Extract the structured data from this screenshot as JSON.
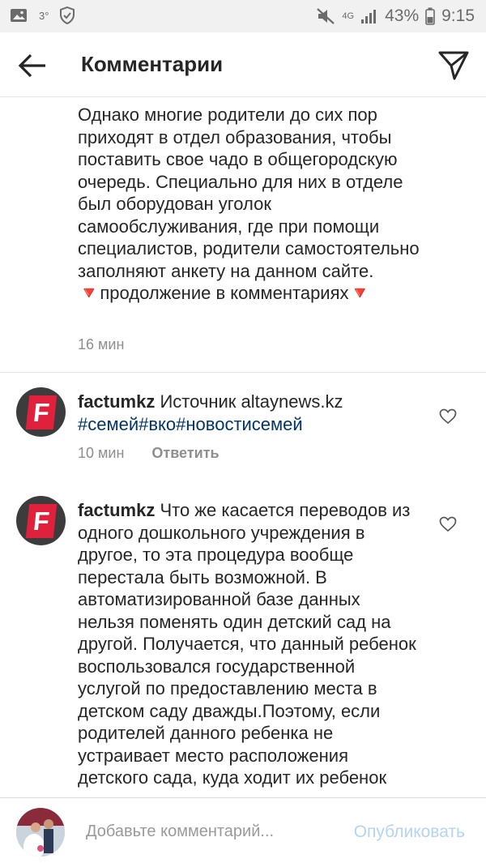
{
  "status_bar": {
    "temperature": "3°",
    "network": "4G",
    "battery": "43%",
    "time": "9:15"
  },
  "header": {
    "title": "Комментарии"
  },
  "caption": {
    "text": "Однако многие родители до сих пор приходят в отдел образования, чтобы поставить свое чадо в общегородскую очередь. Специально для них в отделе был оборудован уголок самообслуживания, где при помощи специалистов, родители самостоятельно заполняют анкету на данном сайте. 🔻продолжение в комментариях🔻",
    "time": "16 мин"
  },
  "comments": [
    {
      "username": "factumkz",
      "text": " Источник altaynews.kz",
      "hashtags": "#семей#вко#новостисемей",
      "time": "10 мин",
      "reply_label": "Ответить",
      "avatar_letter": "F"
    },
    {
      "username": "factumkz",
      "text": " Что же касается переводов из одного дошкольного учреждения в другое, то эта процедура вообще перестала быть возможной. В автоматизированной базе данных нельзя поменять один детский сад на другой. Получается, что данный ребенок воспользовался государственной услугой по предоставлению места в детском саду дважды.Поэтому, если родителей данного ребенка не устраивает место расположения детского сада, куда ходит их ребенок",
      "avatar_letter": "F"
    }
  ],
  "input_bar": {
    "placeholder": "Добавьте комментарий...",
    "publish_label": "Опубликовать"
  }
}
